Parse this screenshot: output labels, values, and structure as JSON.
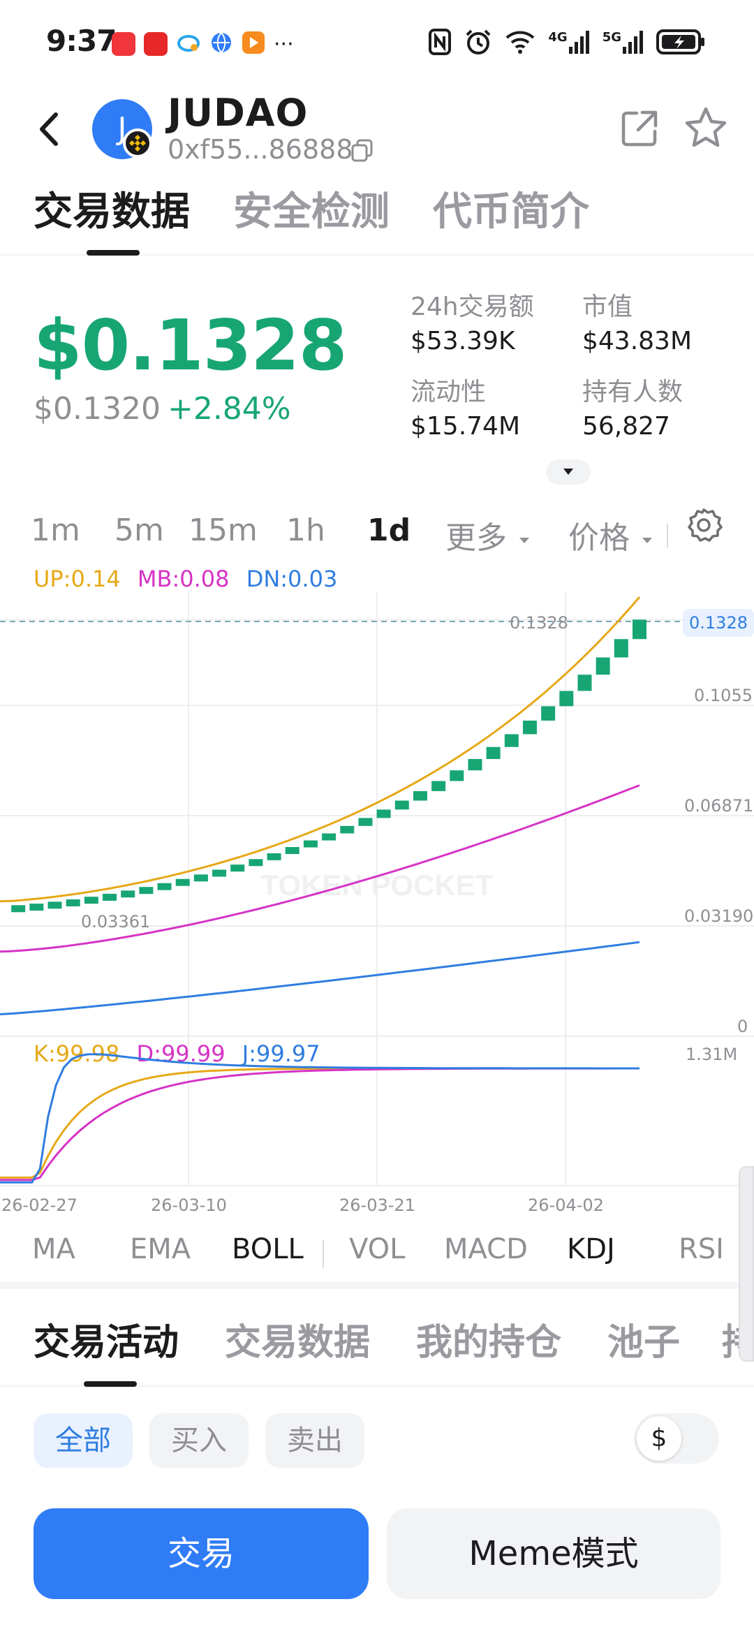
{
  "status_bar": {
    "time": "9:37",
    "more_indicator": "···",
    "network_1": "4G",
    "network_2": "5G",
    "icons": [
      "nfc-icon",
      "alarm-icon",
      "wifi-icon",
      "signal-icon",
      "battery-charging-icon"
    ]
  },
  "header": {
    "avatar_letter": "J",
    "token_name": "JUDAO",
    "address": "0xf55...86888"
  },
  "top_tabs": [
    "交易数据",
    "安全检测",
    "代币简介"
  ],
  "price": {
    "current": "$0.1328",
    "reference": "$0.1320",
    "change": "+2.84%",
    "positive_color": "#17a673"
  },
  "stats": [
    {
      "label": "24h交易额",
      "value": "$53.39K"
    },
    {
      "label": "市值",
      "value": "$43.83M"
    },
    {
      "label": "流动性",
      "value": "$15.74M"
    },
    {
      "label": "持有人数",
      "value": "56,827"
    }
  ],
  "timeframes": [
    "1m",
    "5m",
    "15m",
    "1h",
    "1d"
  ],
  "timeframe_active": "1d",
  "more_label": "更多",
  "price_label": "价格",
  "boll_legend": {
    "up": "UP:0.14",
    "mb": "MB:0.08",
    "dn": "DN:0.03"
  },
  "kdj_legend": {
    "k": "K:99.98",
    "d": "D:99.99",
    "j": "J:99.97"
  },
  "chart_watermark": "TOKEN POCKET",
  "price_axis": [
    "0.1055",
    "0.06871",
    "0.03190",
    "0"
  ],
  "current_price_tag": "0.1328",
  "current_price_line_label": "0.1328",
  "low_marker": "0.03361",
  "volume_axis": "1.31M",
  "x_axis_dates": [
    "26-02-27",
    "26-03-10",
    "26-03-21",
    "26-04-02"
  ],
  "chart_data": {
    "type": "line",
    "x": [
      "26-02-27",
      "26-03-10",
      "26-03-21",
      "26-04-02"
    ],
    "y_axis_ticks": [
      0,
      0.0319,
      0.06871,
      0.1055
    ],
    "current_price": 0.1328,
    "marked_low": 0.03361,
    "boll": {
      "up": 0.14,
      "mb": 0.08,
      "dn": 0.03
    },
    "kdj": {
      "k": 99.98,
      "d": 99.99,
      "j": 99.97
    },
    "colors": {
      "up": "#e6a817",
      "mb": "#d633c6",
      "dn": "#2f7de0",
      "candle": "#17a673"
    }
  },
  "indicators": [
    "MA",
    "EMA",
    "BOLL",
    "VOL",
    "MACD",
    "KDJ",
    "RSI"
  ],
  "indicators_active": [
    "BOLL",
    "KDJ"
  ],
  "activity_tabs": [
    "交易活动",
    "交易数据",
    "我的持仓",
    "池子",
    "持"
  ],
  "filters": [
    "全部",
    "买入",
    "卖出"
  ],
  "currency_symbol": "$",
  "buttons": {
    "trade": "交易",
    "meme": "Meme模式"
  },
  "accent_color": "#2f7cf6"
}
